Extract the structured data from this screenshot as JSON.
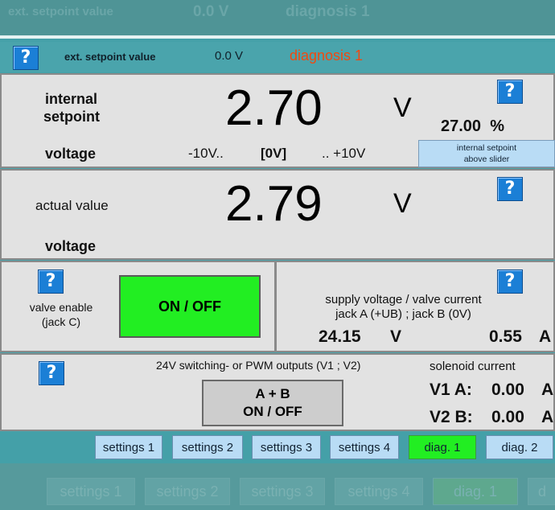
{
  "ghost_top": {
    "label": "ext. setpoint value",
    "value": "0.0 V",
    "mode": "diagnosis 1"
  },
  "header": {
    "label": "ext. setpoint value",
    "value": "0.0 V",
    "mode": "diagnosis 1",
    "mode_color": "#f04a10"
  },
  "internal": {
    "title_line1": "internal",
    "title_line2": "setpoint",
    "sub": "voltage",
    "value": "2.70",
    "unit": "V",
    "percent": "27.00",
    "percent_unit": "%",
    "range_low": "-10V..",
    "range_mid": "[0V]",
    "range_high": ".. +10V",
    "slider_btn_line1": "internal setpoint",
    "slider_btn_line2": "above slider"
  },
  "actual": {
    "title": "actual value",
    "sub": "voltage",
    "value": "2.79",
    "unit": "V"
  },
  "valve": {
    "label_line1": "valve enable",
    "label_line2": "(jack C)",
    "button": "ON / OFF",
    "button_color": "#22ee22"
  },
  "supply": {
    "line1": "supply voltage / valve current",
    "line2": "jack A (+UB) ; jack B (0V)",
    "voltage": "24.15",
    "voltage_unit": "V",
    "current": "0.55",
    "current_unit": "A"
  },
  "outputs": {
    "title": "24V switching- or PWM outputs (V1 ; V2)",
    "button_line1": "A + B",
    "button_line2": "ON / OFF",
    "solenoid_title": "solenoid current",
    "v1_label": "V1 A:",
    "v1_value": "0.00",
    "v1_unit": "A",
    "v2_label": "V2 B:",
    "v2_value": "0.00",
    "v2_unit": "A"
  },
  "help_glyph": "?",
  "tabs": [
    "settings 1",
    "settings 2",
    "settings 3",
    "settings 4",
    "diag. 1",
    "diag. 2"
  ],
  "active_tab_color": "#22ee22",
  "ghost_tabs": [
    "settings 1",
    "settings 2",
    "settings 3",
    "settings 4",
    "diag. 1",
    "d"
  ]
}
